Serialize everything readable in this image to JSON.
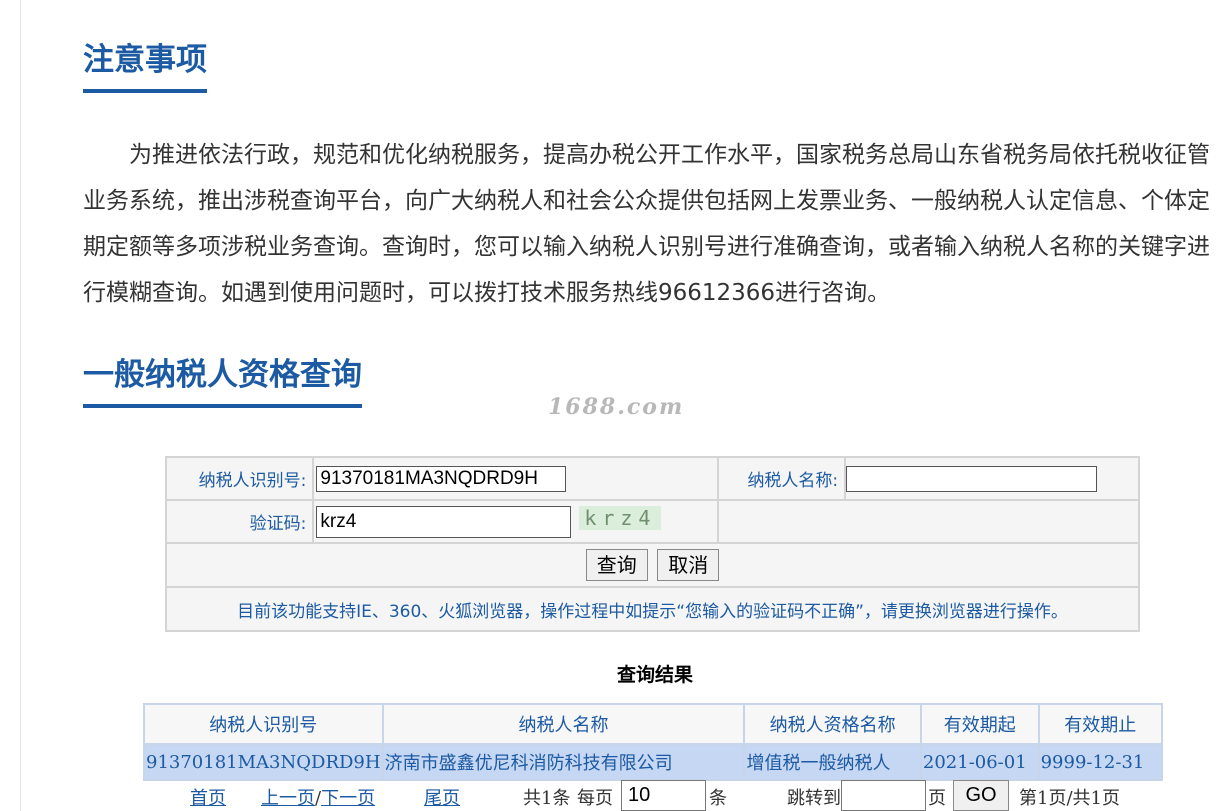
{
  "notice_section": {
    "title": "注意事项",
    "body": "为推进依法行政，规范和优化纳税服务，提高办税公开工作水平，国家税务总局山东省税务局依托税收征管业务系统，推出涉税查询平台，向广大纳税人和社会公众提供包括网上发票业务、一般纳税人认定信息、个体定期定额等多项涉税业务查询。查询时，您可以输入纳税人识别号进行准确查询，或者输入纳税人名称的关键字进行模糊查询。如遇到使用问题时，可以拨打技术服务热线96612366进行咨询。"
  },
  "query_section": {
    "title": "一般纳税人资格查询",
    "watermark": "1688.com"
  },
  "form": {
    "taxpayer_id_label": "纳税人识别号:",
    "taxpayer_id_value": "91370181MA3NQDRD9H",
    "taxpayer_name_label": "纳税人名称:",
    "taxpayer_name_value": "",
    "captcha_label": "验证码:",
    "captcha_value": "krz4",
    "captcha_image_text": "krz4",
    "query_button": "查询",
    "cancel_button": "取消",
    "browser_notice": "目前该功能支持IE、360、火狐浏览器，操作过程中如提示“您输入的验证码不正确”，请更换浏览器进行操作。"
  },
  "results": {
    "title": "查询结果",
    "columns": [
      "纳税人识别号",
      "纳税人名称",
      "纳税人资格名称",
      "有效期起",
      "有效期止"
    ],
    "rows": [
      [
        "91370181MA3NQDRD9H",
        "济南市盛鑫优尼科消防科技有限公司",
        "增值税一般纳税人",
        "2021-06-01",
        "9999-12-31"
      ]
    ]
  },
  "pager": {
    "first": "首页",
    "prev": "上一页",
    "separator": "/",
    "next": "下一页",
    "last": "尾页",
    "total_text": "共1条",
    "per_page_label": "每页",
    "per_page_value": "10",
    "per_page_unit": "条",
    "jump_label": "跳转到",
    "jump_value": "",
    "jump_unit": "页",
    "go_button": "GO",
    "page_status": "第1页/共1页"
  },
  "colors": {
    "accent_blue": "#1c5aa3",
    "result_row_bg": "#c5d7f2"
  }
}
